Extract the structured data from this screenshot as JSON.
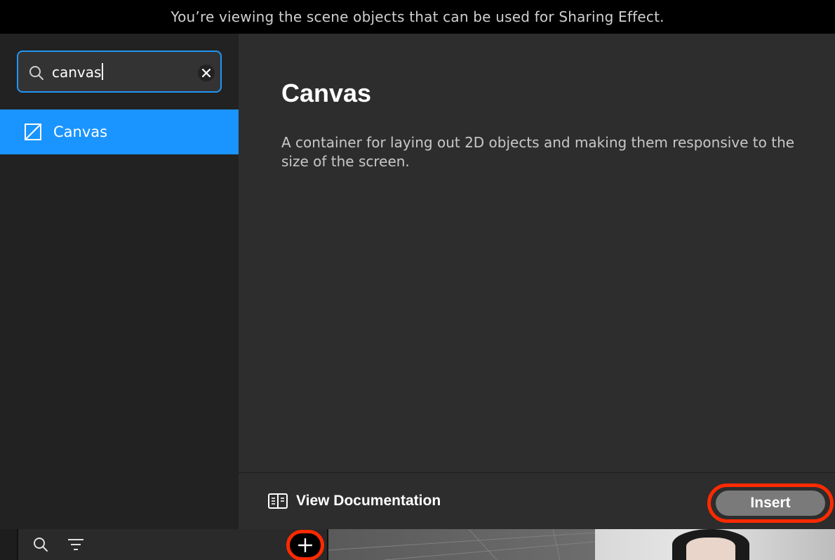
{
  "banner": {
    "text": "You’re viewing the scene objects that can be used for Sharing Effect."
  },
  "sidebar": {
    "search": {
      "value": "canvas",
      "clear_icon": "close-icon",
      "icon": "search-icon"
    },
    "results": [
      {
        "label": "Canvas",
        "icon": "canvas-icon",
        "selected": true
      }
    ]
  },
  "detail": {
    "title": "Canvas",
    "description": "A container for laying out 2D objects and making them responsive to the size of the screen."
  },
  "footer": {
    "doc_link_label": "View Documentation",
    "doc_icon": "book-icon",
    "insert_label": "Insert"
  },
  "bottom_toolbar": {
    "icons": [
      "search-icon",
      "filter-icon",
      "add-icon"
    ]
  },
  "colors": {
    "accent": "#1a94ff",
    "focus_border": "#2196f3",
    "highlight_annotation": "#ff2a00",
    "panel_bg": "#2d2d2d",
    "sidebar_bg": "#222222"
  }
}
